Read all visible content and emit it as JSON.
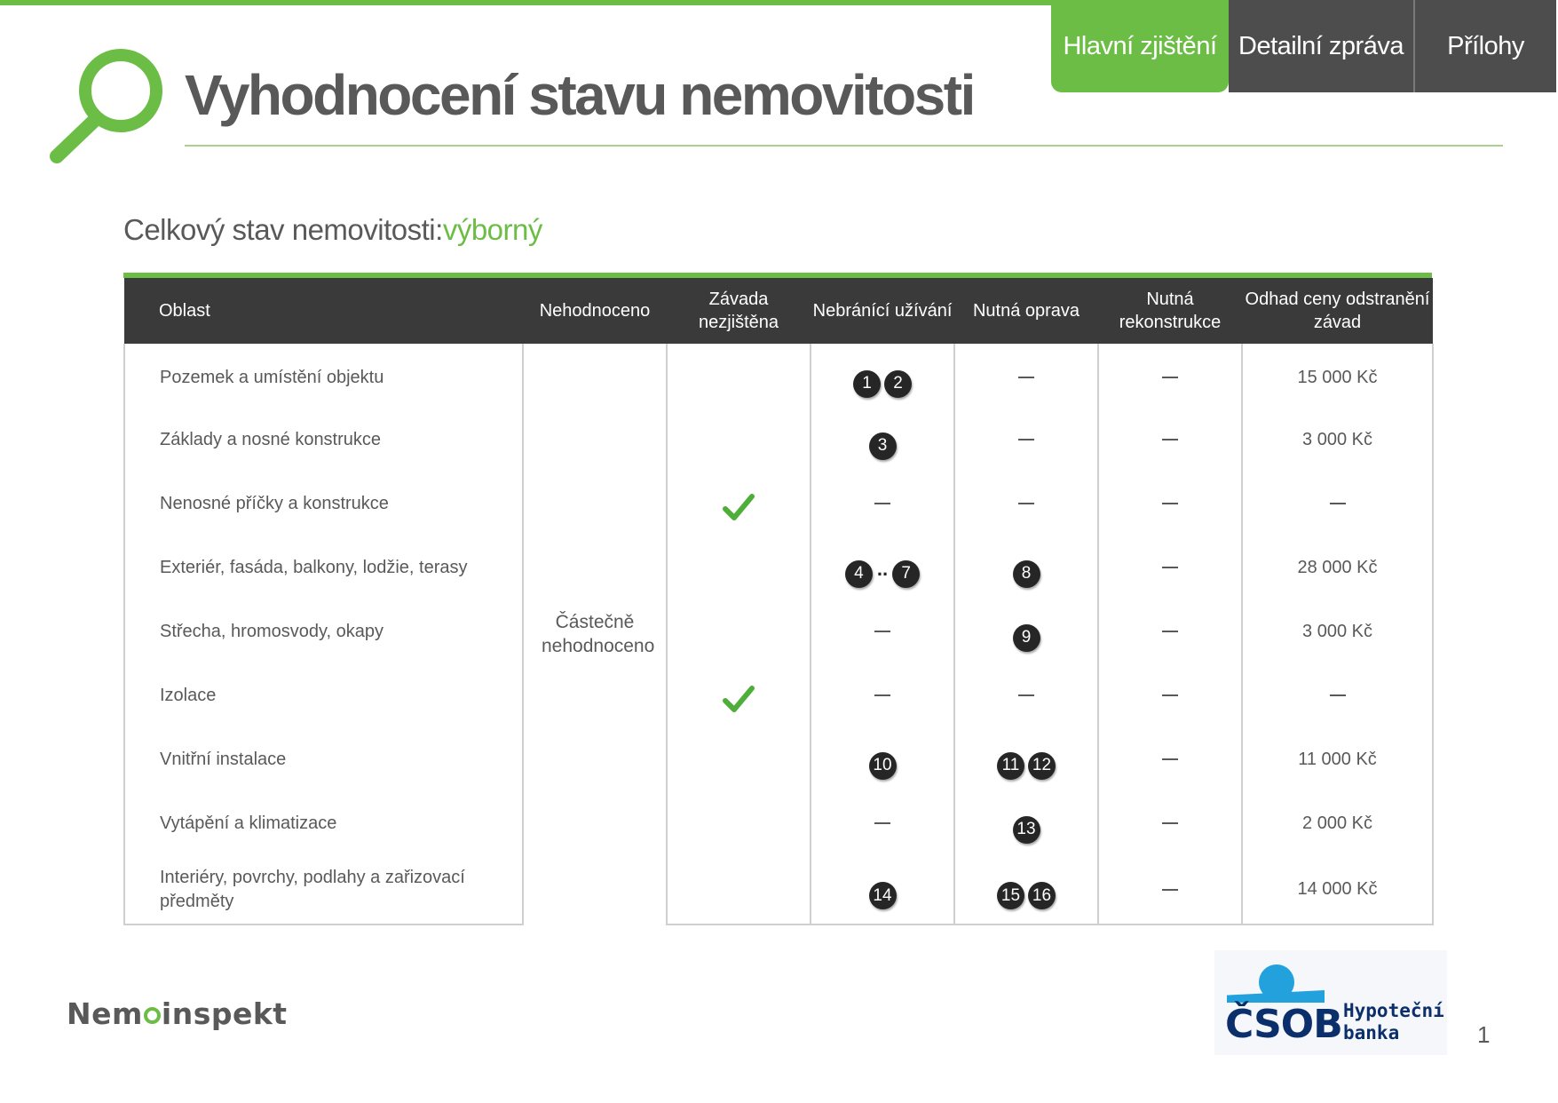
{
  "nav": {
    "tabs": [
      {
        "label": "Hlavní zjištění",
        "active": true
      },
      {
        "label": "Detailní zpráva",
        "active": false
      },
      {
        "label": "Přílohy",
        "active": false
      }
    ]
  },
  "header": {
    "title": "Vyhodnocení stavu nemovitosti"
  },
  "overall": {
    "label": "Celkový stav nemovitosti:",
    "value": "výborný"
  },
  "colors": {
    "accent": "#6cbd45",
    "header_bg": "#3a3a3a",
    "tab_bg": "#4d4d4d",
    "badge": "#262626",
    "csob_blue": "#0b2f6b",
    "csob_light": "#22a1dc"
  },
  "table": {
    "headers": [
      "Oblast",
      "Nehodnoceno",
      "Závada nezjištěna",
      "Nebránící užívání",
      "Nutná oprava",
      "Nutná rekonstrukce",
      "Odhad ceny odstranění závad"
    ],
    "merged_nehodnoceno": "Částečně nehodnoceno",
    "rows": [
      {
        "area": "Pozemek a umístění objektu",
        "zavada_nezjistena": false,
        "nebranici": [
          "1",
          "2"
        ],
        "nutna_oprava": [],
        "rekonstrukce": [],
        "cena": "15 000 Kč"
      },
      {
        "area": "Základy a nosné konstrukce",
        "zavada_nezjistena": false,
        "nebranici": [
          "3"
        ],
        "nutna_oprava": [],
        "rekonstrukce": [],
        "cena": "3 000 Kč"
      },
      {
        "area": "Nenosné příčky a konstrukce",
        "zavada_nezjistena": true,
        "nebranici": [],
        "nutna_oprava": [],
        "rekonstrukce": [],
        "cena": ""
      },
      {
        "area": "Exteriér, fasáda, balkony, lodžie, terasy",
        "zavada_nezjistena": false,
        "nebranici": [
          "4",
          "..",
          "7"
        ],
        "nutna_oprava": [
          "8"
        ],
        "rekonstrukce": [],
        "cena": "28 000 Kč"
      },
      {
        "area": "Střecha, hromosvody, okapy",
        "zavada_nezjistena": false,
        "nebranici": [],
        "nutna_oprava": [
          "9"
        ],
        "rekonstrukce": [],
        "cena": "3 000 Kč"
      },
      {
        "area": "Izolace",
        "zavada_nezjistena": true,
        "nebranici": [],
        "nutna_oprava": [],
        "rekonstrukce": [],
        "cena": ""
      },
      {
        "area": "Vnitřní instalace",
        "zavada_nezjistena": false,
        "nebranici": [
          "10"
        ],
        "nutna_oprava": [
          "11",
          "12"
        ],
        "rekonstrukce": [],
        "cena": "11 000 Kč"
      },
      {
        "area": "Vytápění a klimatizace",
        "zavada_nezjistena": false,
        "nebranici": [],
        "nutna_oprava": [
          "13"
        ],
        "rekonstrukce": [],
        "cena": "2 000 Kč"
      },
      {
        "area": "Interiéry, povrchy, podlahy a zařizovací předměty",
        "zavada_nezjistena": false,
        "nebranici": [
          "14"
        ],
        "nutna_oprava": [
          "15",
          "16"
        ],
        "rekonstrukce": [],
        "cena": "14 000 Kč"
      }
    ]
  },
  "footer": {
    "nemo_prefix": "Nem",
    "nemo_suffix": "inspekt",
    "csob_word": "ČSOB",
    "csob_line1": "Hypoteční",
    "csob_line2": "banka",
    "page_number": "1"
  },
  "icons": [
    "magnifier-logo-icon",
    "check-icon",
    "csob-logo-icon"
  ]
}
